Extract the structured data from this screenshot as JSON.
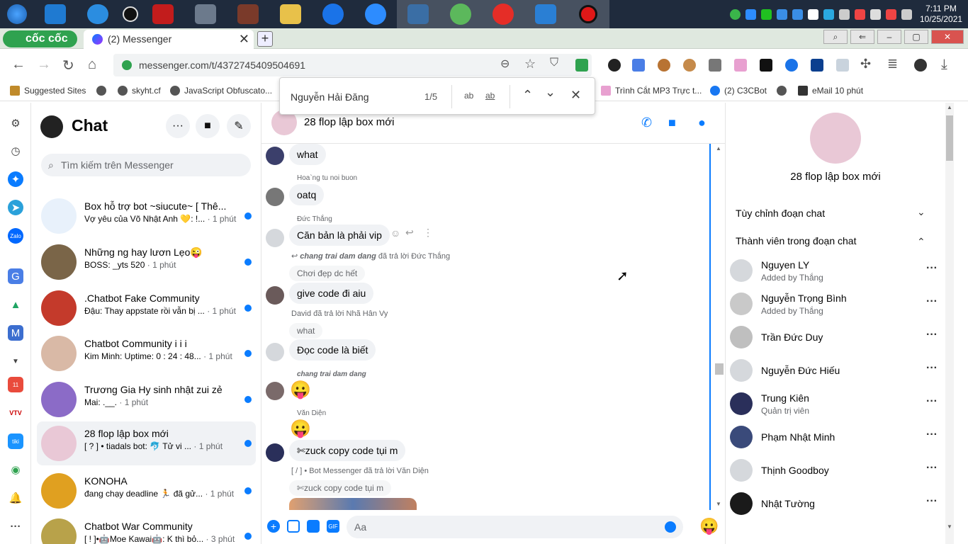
{
  "taskbar": {
    "apps": [
      "vscode",
      "onedrive",
      "obs",
      "garena",
      "ai",
      "game",
      "explorer",
      "zalo",
      "zoom",
      "remote",
      "coccoc",
      "youtube",
      "screen",
      "record"
    ],
    "time": "7:11 PM",
    "date": "10/25/2021"
  },
  "browser": {
    "brand": "cốc cốc",
    "tab_title": "(2) Messenger",
    "url": "messenger.com/t/4372745409504691",
    "bookmarks": [
      "Suggested Sites",
      "skyht.cf",
      "JavaScript Obfuscato...",
      "Trình Cắt MP3 Trực t...",
      "(2) C3CBot",
      "eMail 10 phút"
    ]
  },
  "find": {
    "query": "Nguyễn Hải Đăng",
    "count": "1/5",
    "opt1": "ab",
    "opt2": "ab"
  },
  "chatlist": {
    "title": "Chat",
    "search_placeholder": "Tìm kiếm trên Messenger",
    "conversations": [
      {
        "name": "Box hỗ trợ bot ~siucute~ [ Thê...",
        "preview": "Vợ yêu của Võ Nhật Anh 💛: !...",
        "time": "· 1 phút",
        "color": "#e8f1fb"
      },
      {
        "name": "Những ng hay lươn Lẹo😜",
        "preview": "BOSS: _yts 520",
        "time": "· 1 phút",
        "color": "#7a6548"
      },
      {
        "name": ".Chatbot Fake Community",
        "preview": "Đậu: Thay appstate rồi vẫn bị ...",
        "time": "· 1 phút",
        "color": "#c43a2b"
      },
      {
        "name": "Chatbot Community i i i",
        "preview": "Kim Minh: Uptime: 0 : 24 : 48...",
        "time": "· 1 phút",
        "color": "#d9b9a6"
      },
      {
        "name": "Trương Gia Hy sinh nhật zui zẻ",
        "preview": "Mai: .__.",
        "time": "· 1 phút",
        "color": "#8b6bc7"
      },
      {
        "name": "28 flop lập box mới",
        "preview": "[ ? ] • tiadals bot: 🐬 Tử vi ...",
        "time": "· 1 phút",
        "color": "#e9c8d6"
      },
      {
        "name": "KONOHA",
        "preview": "đang chạy deadline 🏃 đã gử...",
        "time": "· 1 phút",
        "color": "#e0a020"
      },
      {
        "name": "Chatbot War Community",
        "preview": "[ ! ]•🤖Moe Kawai🤖: K thì bỏ...",
        "time": "· 3 phút",
        "color": "#b8a24a"
      }
    ]
  },
  "chat": {
    "title": "28 flop lập box mới",
    "messages": {
      "m1": "what",
      "s2": "Hoa`ng tu noi buon",
      "m2": "oatq",
      "s3": "Đức Thắng",
      "m3": "Căn bản là phải vip",
      "r4_name": "chang trai dam dang",
      "r4_rest": " đã trả lời Đức Thắng",
      "q4": "Chơi đẹp dc hết",
      "m4": "give code đi aiu",
      "r5": "David đã trả lời Nhã Hân Vy",
      "q5": "what",
      "m5": "Đọc code là biết",
      "s6": "chang trai dam dang",
      "e6": "😛",
      "s7": "Văn Diện",
      "e7": "😛",
      "m7": "✄zuck copy code tụi m",
      "r8": "[ / ] • Bot Messenger đã trả lời Văn Diện",
      "q8": "✄zuck copy code tụi m"
    },
    "composer_placeholder": "Aa"
  },
  "info": {
    "title": "28 flop lập box mới",
    "section1": "Tùy chỉnh đoạn chat",
    "section2": "Thành viên trong đoạn chat",
    "members": [
      {
        "name": "Nguyen LY",
        "sub": "Added by Thắng",
        "color": "#d5d8dc"
      },
      {
        "name": "Nguyễn Trọng Bình",
        "sub": "Added by Thắng",
        "color": "#c9c9c9"
      },
      {
        "name": "Trần Đức Duy",
        "sub": "",
        "color": "#bfbfbf"
      },
      {
        "name": "Nguyễn Đức Hiếu",
        "sub": "",
        "color": "#d5d8dc"
      },
      {
        "name": "Trung Kiên",
        "sub": "Quản trị viên",
        "color": "#2a2f5a"
      },
      {
        "name": "Phạm Nhật Minh",
        "sub": "",
        "color": "#3a4a7a"
      },
      {
        "name": "Thịnh Goodboy",
        "sub": "",
        "color": "#d5d8dc"
      },
      {
        "name": "Nhật Tường",
        "sub": "",
        "color": "#1a1a1a"
      }
    ]
  }
}
